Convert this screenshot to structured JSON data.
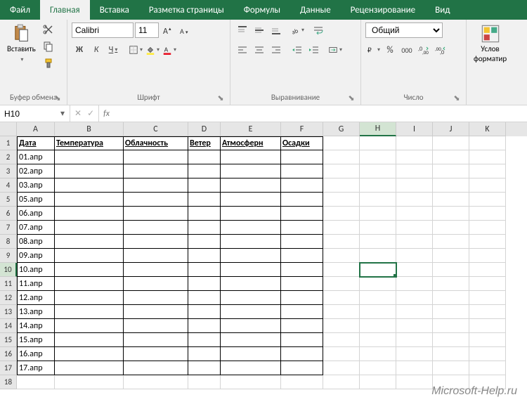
{
  "tabs": [
    "Файл",
    "Главная",
    "Вставка",
    "Разметка страницы",
    "Формулы",
    "Данные",
    "Рецензирование",
    "Вид"
  ],
  "clipboard": {
    "paste": "Вставить",
    "label": "Буфер обмена"
  },
  "font": {
    "name": "Calibri",
    "size": "11",
    "bold": "Ж",
    "italic": "К",
    "underline": "Ч",
    "label": "Шрифт"
  },
  "align": {
    "label": "Выравнивание"
  },
  "number": {
    "format": "Общий",
    "label": "Число"
  },
  "cond": {
    "line1": "Услов",
    "line2": "форматир"
  },
  "namebox": "H10",
  "watermark": "Microsoft-Help.ru",
  "columns": {
    "A": 54,
    "B": 98,
    "C": 92,
    "D": 46,
    "E": 86,
    "F": 60,
    "G": 52,
    "H": 52,
    "I": 52,
    "J": 52,
    "K": 52
  },
  "headers": [
    "Дата",
    "Температура",
    "Облачность",
    "Ветер",
    "Атмосферн",
    "Осадки"
  ],
  "dates": [
    "01.апр",
    "02.апр",
    "03.апр",
    "05.апр",
    "06.апр",
    "07.апр",
    "08.апр",
    "09.апр",
    "10.апр",
    "11.апр",
    "12.апр",
    "13.апр",
    "14.апр",
    "15.апр",
    "16.апр",
    "17.апр"
  ],
  "active_cell": "H10"
}
